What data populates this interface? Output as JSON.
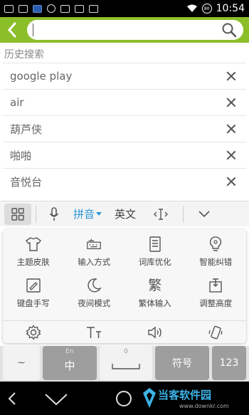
{
  "status_bar": {
    "time": "10:54",
    "battery": "80"
  },
  "search": {
    "value": "",
    "placeholder": ""
  },
  "history": {
    "title": "历史搜索",
    "items": [
      "google play",
      "air",
      "葫芦侠",
      "啪啪",
      "音悦台"
    ]
  },
  "keyboard_toolbar": {
    "pinyin": "拼音",
    "english": "英文"
  },
  "keyboard_panel": {
    "row1": [
      "主题皮肤",
      "输入方式",
      "词库优化",
      "智能纠错"
    ],
    "row2": [
      "键盘手写",
      "夜间模式",
      "繁体输入",
      "调整高度"
    ],
    "traditional_glyph": "繁"
  },
  "keys": {
    "tilde": "~",
    "zhong": "中",
    "zhong_sub": "En",
    "space_sub": "0",
    "symbol": "符号",
    "num": "123"
  },
  "watermark": {
    "name": "当客软件园",
    "url": "www.downkr.com"
  },
  "colors": {
    "header": "#8bbf2a",
    "pinyin_accent": "#2d97d7"
  }
}
